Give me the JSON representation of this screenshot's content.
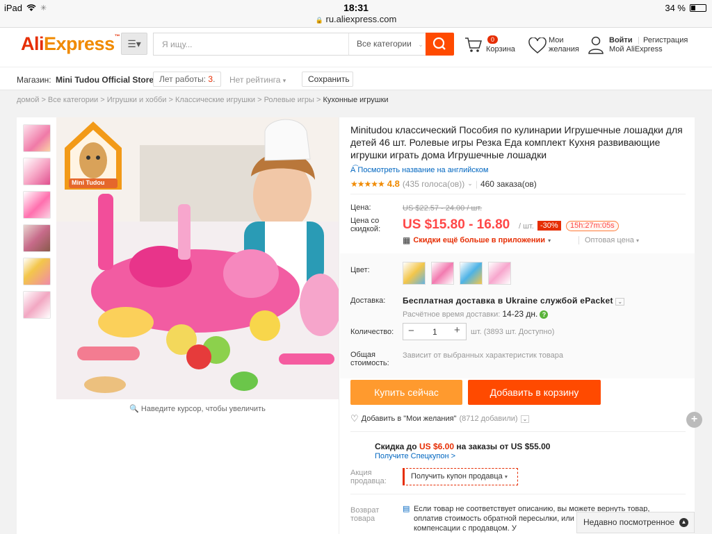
{
  "status_bar": {
    "device": "iPad",
    "time": "18:31",
    "battery": "34 %",
    "url": "ru.aliexpress.com"
  },
  "header": {
    "logo": {
      "ali": "Ali",
      "express": "Express"
    },
    "search_placeholder": "Я ищу...",
    "category_select": "Все категории",
    "cart_count": "0",
    "cart_label": "Корзина",
    "wishlist_line1": "Мои",
    "wishlist_line2": "желания",
    "signin": "Войти",
    "register": "Регистрация",
    "my_account": "Мой AliExpress"
  },
  "store_bar": {
    "store_label": "Магазин:",
    "store_name": "Mini Tudou Official Store",
    "years_label": "Лет работы:",
    "years_value": "3",
    "rating_chip": "Нет рейтинга",
    "save_button": "Сохранить"
  },
  "breadcrumb": [
    "домой",
    "Все категории",
    "Игрушки и хобби",
    "Классические игрушки",
    "Ролевые игры",
    "Кухонные игрушки"
  ],
  "gallery": {
    "zoom_hint": "Наведите курсор, чтобы увеличить",
    "brand_badge": "Mini Tudou"
  },
  "product": {
    "title": "Minitudou классический Пособия по кулинарии Игрушечные лошадки для детей 46 шт. Ролевые игры Резка Еда комплект Кухня развивающие игрушки играть дома Игрушечные лошадки",
    "translate_link": "Посмотреть название на английском",
    "rating": "4.8",
    "votes": "(435 голоса(ов))",
    "orders": "460 заказа(ов)",
    "price_label": "Цена:",
    "old_price": "US $22.57 - 24.00 / шт.",
    "discount_price_label_1": "Цена со",
    "discount_price_label_2": "скидкой:",
    "price": "US $15.80 - 16.80",
    "unit": "/ шт.",
    "discount": "-30%",
    "timer": "15h:27m:05s",
    "app_promo": "Скидки ещё больше в приложении",
    "wholesale": "Оптовая цена",
    "color_label": "Цвет:",
    "shipping_label": "Доставка:",
    "shipping_text": "Бесплатная доставка в Ukraine службой ePacket",
    "delivery_time_label": "Расчётное время доставки:",
    "delivery_time": "14-23 дн.",
    "quantity_label": "Количество:",
    "quantity": "1",
    "stock": "шт. (3893 шт. Доступно)",
    "total_label_1": "Общая",
    "total_label_2": "стоимость:",
    "total_text": "Зависит от выбранных характеристик товара",
    "buy_now": "Купить сейчас",
    "add_to_cart": "Добавить в корзину",
    "add_wishlist": "Добавить в \"Мои желания\"",
    "wishlist_count": "(8712 добавили)",
    "coupon_prefix": "Скидка до",
    "coupon_amount": "US $6.00",
    "coupon_suffix": "на заказы от US $55.00",
    "get_coupon": "Получите Спецкупон >",
    "seller_promo_label_1": "Акция",
    "seller_promo_label_2": "продавца:",
    "seller_coupon": "Получить купон продавца",
    "return_label_1": "Возврат",
    "return_label_2": "товара",
    "return_text": "Если товар не соответствует описанию, вы можете вернуть товар, оплатив стоимость обратной пересылки, или договориться о компенсации с продавцом. У"
  },
  "recently_viewed": "Недавно посмотренное",
  "colors": {
    "brand": "#e62e04",
    "orange": "#ff4a00",
    "buy_now": "#ff9a2e",
    "price": "#ff4747",
    "link": "#0066c0"
  }
}
